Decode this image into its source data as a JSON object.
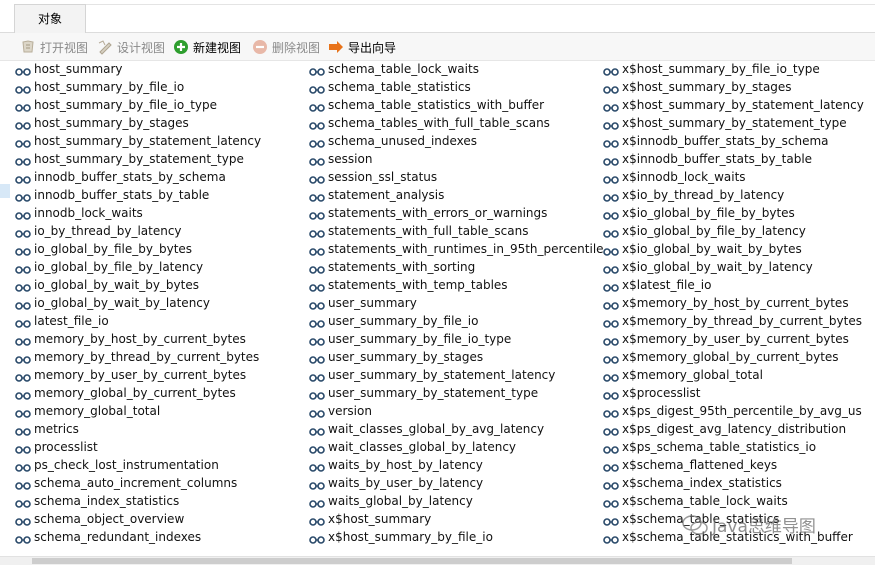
{
  "tab": {
    "label": "对象"
  },
  "toolbar": {
    "open_view": "打开视图",
    "design_view": "设计视图",
    "new_view": "新建视图",
    "delete_view": "删除视图",
    "export_wizard": "导出向导"
  },
  "columns": [
    [
      "host_summary",
      "host_summary_by_file_io",
      "host_summary_by_file_io_type",
      "host_summary_by_stages",
      "host_summary_by_statement_latency",
      "host_summary_by_statement_type",
      "innodb_buffer_stats_by_schema",
      "innodb_buffer_stats_by_table",
      "innodb_lock_waits",
      "io_by_thread_by_latency",
      "io_global_by_file_by_bytes",
      "io_global_by_file_by_latency",
      "io_global_by_wait_by_bytes",
      "io_global_by_wait_by_latency",
      "latest_file_io",
      "memory_by_host_by_current_bytes",
      "memory_by_thread_by_current_bytes",
      "memory_by_user_by_current_bytes",
      "memory_global_by_current_bytes",
      "memory_global_total",
      "metrics",
      "processlist",
      "ps_check_lost_instrumentation",
      "schema_auto_increment_columns",
      "schema_index_statistics",
      "schema_object_overview",
      "schema_redundant_indexes"
    ],
    [
      "schema_table_lock_waits",
      "schema_table_statistics",
      "schema_table_statistics_with_buffer",
      "schema_tables_with_full_table_scans",
      "schema_unused_indexes",
      "session",
      "session_ssl_status",
      "statement_analysis",
      "statements_with_errors_or_warnings",
      "statements_with_full_table_scans",
      "statements_with_runtimes_in_95th_percentile",
      "statements_with_sorting",
      "statements_with_temp_tables",
      "user_summary",
      "user_summary_by_file_io",
      "user_summary_by_file_io_type",
      "user_summary_by_stages",
      "user_summary_by_statement_latency",
      "user_summary_by_statement_type",
      "version",
      "wait_classes_global_by_avg_latency",
      "wait_classes_global_by_latency",
      "waits_by_host_by_latency",
      "waits_by_user_by_latency",
      "waits_global_by_latency",
      "x$host_summary",
      "x$host_summary_by_file_io"
    ],
    [
      "x$host_summary_by_file_io_type",
      "x$host_summary_by_stages",
      "x$host_summary_by_statement_latency",
      "x$host_summary_by_statement_type",
      "x$innodb_buffer_stats_by_schema",
      "x$innodb_buffer_stats_by_table",
      "x$innodb_lock_waits",
      "x$io_by_thread_by_latency",
      "x$io_global_by_file_by_bytes",
      "x$io_global_by_file_by_latency",
      "x$io_global_by_wait_by_bytes",
      "x$io_global_by_wait_by_latency",
      "x$latest_file_io",
      "x$memory_by_host_by_current_bytes",
      "x$memory_by_thread_by_current_bytes",
      "x$memory_by_user_by_current_bytes",
      "x$memory_global_by_current_bytes",
      "x$memory_global_total",
      "x$processlist",
      "x$ps_digest_95th_percentile_by_avg_us",
      "x$ps_digest_avg_latency_distribution",
      "x$ps_schema_table_statistics_io",
      "x$schema_flattened_keys",
      "x$schema_index_statistics",
      "x$schema_table_lock_waits",
      "x$schema_table_statistics",
      "x$schema_table_statistics_with_buffer"
    ]
  ],
  "watermark": {
    "text": "Java思维导图"
  },
  "icons": {
    "view": "view-glasses-icon"
  },
  "colors": {
    "selection": "#d7e8f7",
    "new_view_green": "#2e9e2e",
    "export_orange": "#e8731a"
  }
}
